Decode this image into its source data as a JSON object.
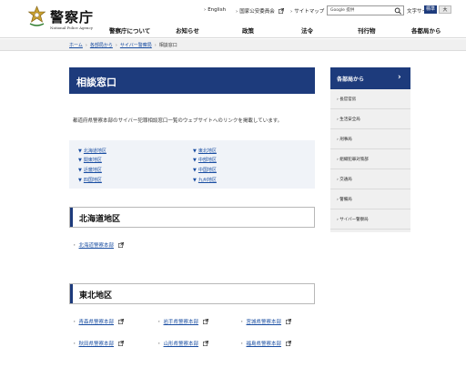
{
  "header": {
    "logo_text": "警察庁",
    "logo_subtext": "National Police Agency",
    "util_links": {
      "english": "English",
      "certification": "国家公安委員会",
      "sitemap": "サイトマップ"
    },
    "search": {
      "provider": "Google 提供"
    },
    "font_size": {
      "label": "文字サイズ",
      "standard": "標準",
      "large": "大"
    },
    "nav": [
      "警察庁について",
      "お知らせ",
      "政策",
      "法令",
      "刊行物",
      "各都局から"
    ]
  },
  "breadcrumb": [
    "ホーム",
    "各部局から",
    "サイバー警察局",
    "相談窓口"
  ],
  "main": {
    "title": "相談窓口",
    "intro": "都道府県警察本部のサイバー犯罪相談窓口一覧のウェブサイトへのリンクを掲載しています。",
    "regions": [
      {
        "label": "北海道地区"
      },
      {
        "label": "東北地区"
      },
      {
        "label": "関東地区"
      },
      {
        "label": "中部地区"
      },
      {
        "label": "近畿地区"
      },
      {
        "label": "中国地区"
      },
      {
        "label": "四国地区"
      },
      {
        "label": "九州地区"
      }
    ],
    "sections": [
      {
        "title": "北海道地区",
        "links": [
          "北海道警察本部"
        ]
      },
      {
        "title": "東北地区",
        "links": [
          "青森県警察本部",
          "岩手県警察本部",
          "宮城県警察本部",
          "秋田県警察本部",
          "山形県警察本部",
          "福島県警察本部"
        ]
      }
    ]
  },
  "sidebar": {
    "title": "各部局から",
    "items": [
      "長官官房",
      "生活安全局",
      "刑事局",
      "組織犯罪対策部",
      "交通局",
      "警備局",
      "サイバー警察局"
    ]
  },
  "colors": {
    "navy": "#1d3b7c",
    "link": "#1a4ea2",
    "panel": "#f0f3f8"
  }
}
